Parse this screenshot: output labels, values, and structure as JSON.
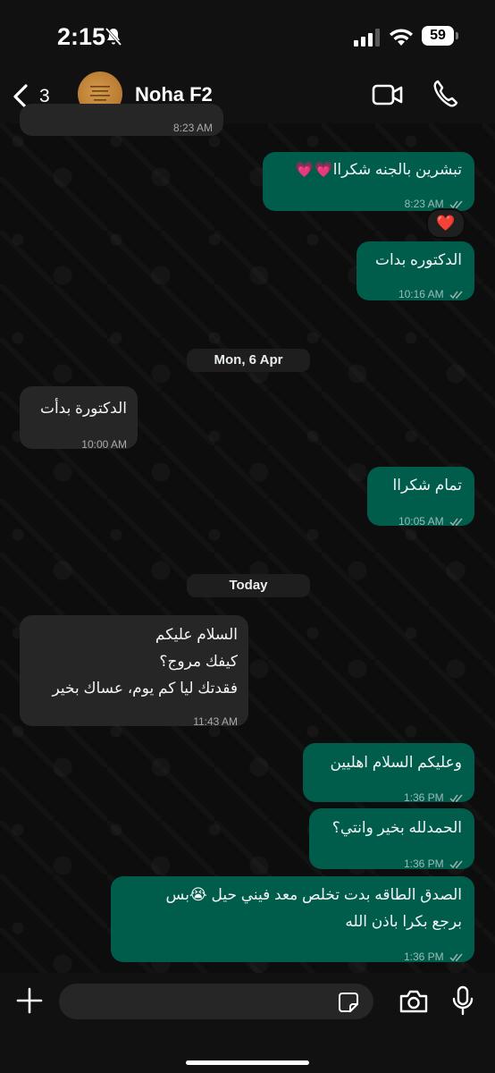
{
  "status_bar": {
    "time": "2:15",
    "battery": "59"
  },
  "header": {
    "back_count": "3",
    "contact_name": "Noha F2"
  },
  "messages": [
    {
      "id": "m0",
      "direction": "in",
      "text": "",
      "time": "8:23 AM"
    },
    {
      "id": "m1",
      "direction": "out",
      "text": "تبشرين بالجنه شكراا💗💗",
      "time": "8:23 AM",
      "reaction": "❤️"
    },
    {
      "id": "m2",
      "direction": "out",
      "text": "الدكتوره بدات",
      "time": "10:16 AM"
    },
    {
      "id": "m3",
      "direction": "in",
      "text": "الدكتورة بدأت",
      "time": "10:00 AM"
    },
    {
      "id": "m4",
      "direction": "out",
      "text": "تمام شكراا",
      "time": "10:05 AM"
    },
    {
      "id": "m5",
      "direction": "in",
      "text": "السلام عليكم\nكيفك مروج؟\nفقدتك ليا كم يوم، عساك بخير",
      "time": "11:43 AM"
    },
    {
      "id": "m6",
      "direction": "out",
      "text": "وعليكم السلام اهليين",
      "time": "1:36 PM"
    },
    {
      "id": "m7",
      "direction": "out",
      "text": "الحمدلله بخير وانتي؟",
      "time": "1:36 PM"
    },
    {
      "id": "m8",
      "direction": "out",
      "text": "الصدق الطاقه بدت تخلص معد فيني حيل 😭بس\nبرجع بكرا باذن الله",
      "time": "1:36 PM"
    }
  ],
  "date_chips": [
    "Mon, 6 Apr",
    "Today"
  ],
  "input": {
    "placeholder": ""
  },
  "icons": [
    "mute-icon",
    "signal-icon",
    "wifi-icon",
    "back-chevron-icon",
    "video-call-icon",
    "phone-icon",
    "read-ticks-icon",
    "plus-icon",
    "sticker-icon",
    "camera-icon",
    "microphone-icon"
  ],
  "colors": {
    "outgoing_bubble": "#005c4b",
    "incoming_bubble": "#262626",
    "background": "#0b0b0b",
    "read_ticks": "#9fb3ad"
  }
}
